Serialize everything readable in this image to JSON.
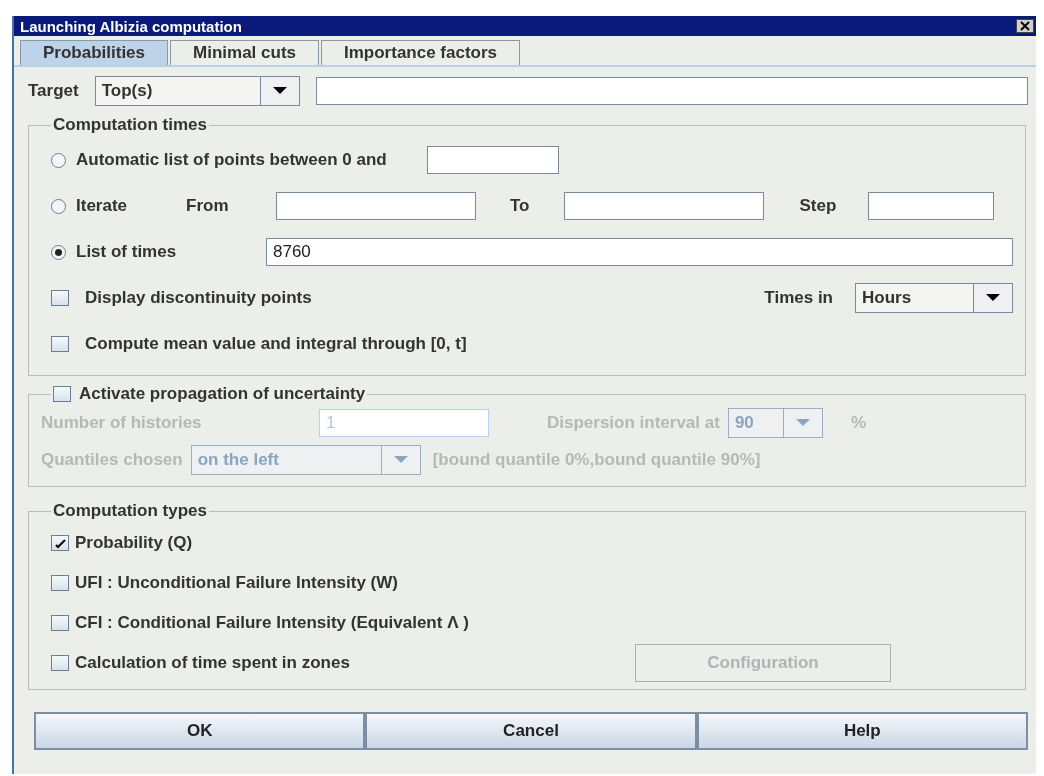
{
  "window": {
    "title": "Launching Albizia computation"
  },
  "tabs": [
    {
      "label": "Probabilities",
      "selected": true
    },
    {
      "label": "Minimal cuts",
      "selected": false
    },
    {
      "label": "Importance factors",
      "selected": false
    }
  ],
  "target": {
    "label": "Target",
    "value": "Top(s)"
  },
  "computation_times": {
    "title": "Computation times",
    "options": [
      {
        "kind": "auto",
        "label": "Automatic list of points between 0 and",
        "selected": false
      },
      {
        "kind": "iterate",
        "label": "Iterate",
        "from_label": "From",
        "to_label": "To",
        "step_label": "Step",
        "selected": false
      },
      {
        "kind": "list",
        "label": "List of times",
        "value": "8760",
        "selected": true
      }
    ],
    "discontinuity": {
      "label": "Display discontinuity points",
      "checked": false
    },
    "times_in": {
      "label": "Times in",
      "value": "Hours"
    },
    "mean": {
      "label": "Compute mean value and integral through [0, t]",
      "checked": false
    }
  },
  "uncertainty": {
    "label": "Activate propagation of uncertainty",
    "checked": false,
    "histories_label": "Number of histories",
    "histories_value": "1",
    "dispersion_label": "Dispersion interval at",
    "dispersion_value": "90",
    "dispersion_unit": "%",
    "quantiles_label": "Quantiles chosen",
    "quantiles_value": "on the left",
    "quantiles_note": "[bound quantile 0%,bound quantile 90%]"
  },
  "computation_types": {
    "title": "Computation types",
    "items": [
      {
        "label": "Probability (Q)",
        "checked": true
      },
      {
        "label": "UFI : Unconditional Failure Intensity (W)",
        "checked": false
      },
      {
        "label": "CFI : Conditional Failure Intensity (Equivalent Λ )",
        "checked": false
      },
      {
        "label": "Calculation of time spent in zones",
        "checked": false
      }
    ],
    "configuration": {
      "label": "Configuration",
      "disabled": true
    }
  },
  "buttons": [
    "OK",
    "Cancel",
    "Help"
  ]
}
